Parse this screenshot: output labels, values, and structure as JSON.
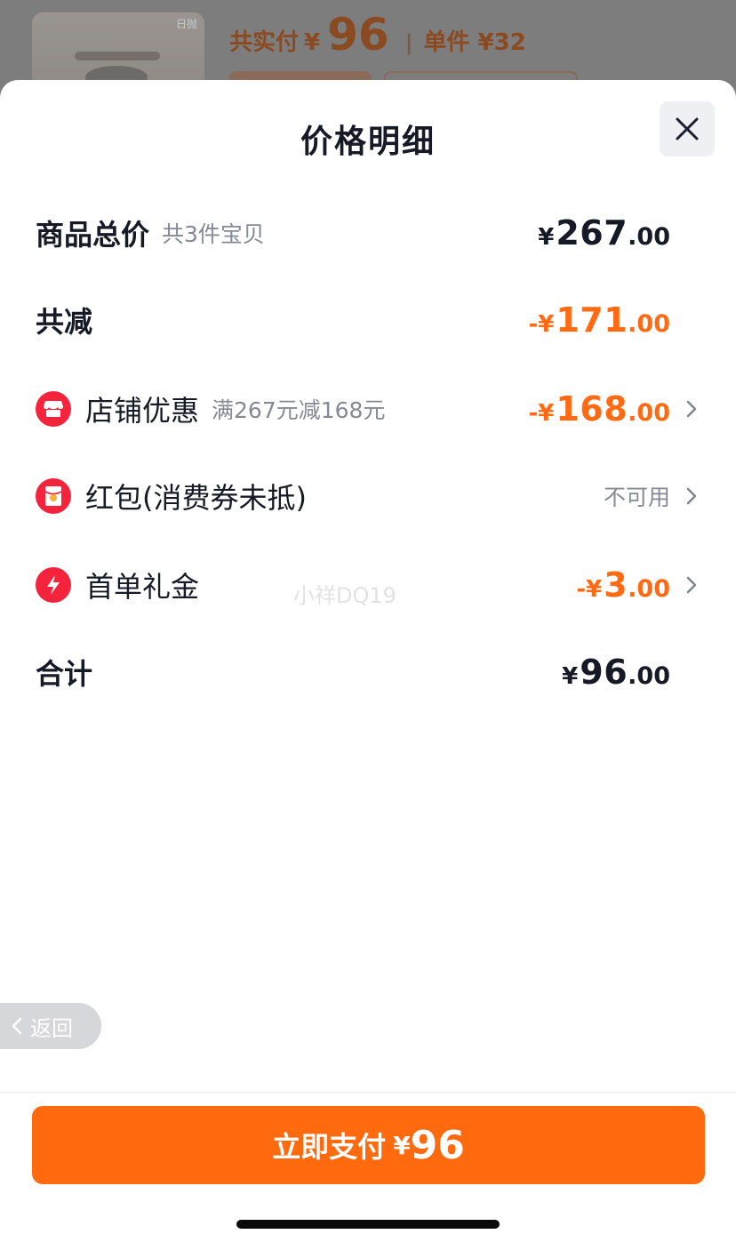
{
  "background": {
    "thumb_tag": "日抛",
    "total_label": "共实付",
    "total_yen": "¥",
    "total_value": "96",
    "separator": "|",
    "unit_price": "单件 ¥32"
  },
  "sheet": {
    "title": "价格明细",
    "rows": {
      "goods_total": {
        "label": "商品总价",
        "sub": "共3件宝贝",
        "yen": "¥",
        "int": "267",
        "dec": ".00"
      },
      "total_reduce": {
        "label": "共减",
        "yen": "-¥",
        "int": "171",
        "dec": ".00"
      },
      "store_discount": {
        "label": "店铺优惠",
        "sub": "满267元减168元",
        "yen": "-¥",
        "int": "168",
        "dec": ".00",
        "icon": "store-icon"
      },
      "red_packet": {
        "label": "红包(消费券未抵)",
        "status": "不可用",
        "icon": "red-packet-icon"
      },
      "first_order": {
        "label": "首单礼金",
        "yen": "-¥",
        "int": "3",
        "dec": ".00",
        "icon": "lightning-icon"
      },
      "sum": {
        "label": "合计",
        "yen": "¥",
        "int": "96",
        "dec": ".00"
      }
    },
    "watermark": "小祥DQ19"
  },
  "back": {
    "label": "返回"
  },
  "pay_button": {
    "label": "立即支付",
    "yen": "¥",
    "value": "96"
  },
  "colors": {
    "accent": "#ff6a12",
    "icon_red": "#f5233b",
    "text": "#151a26",
    "muted": "#848a96"
  }
}
